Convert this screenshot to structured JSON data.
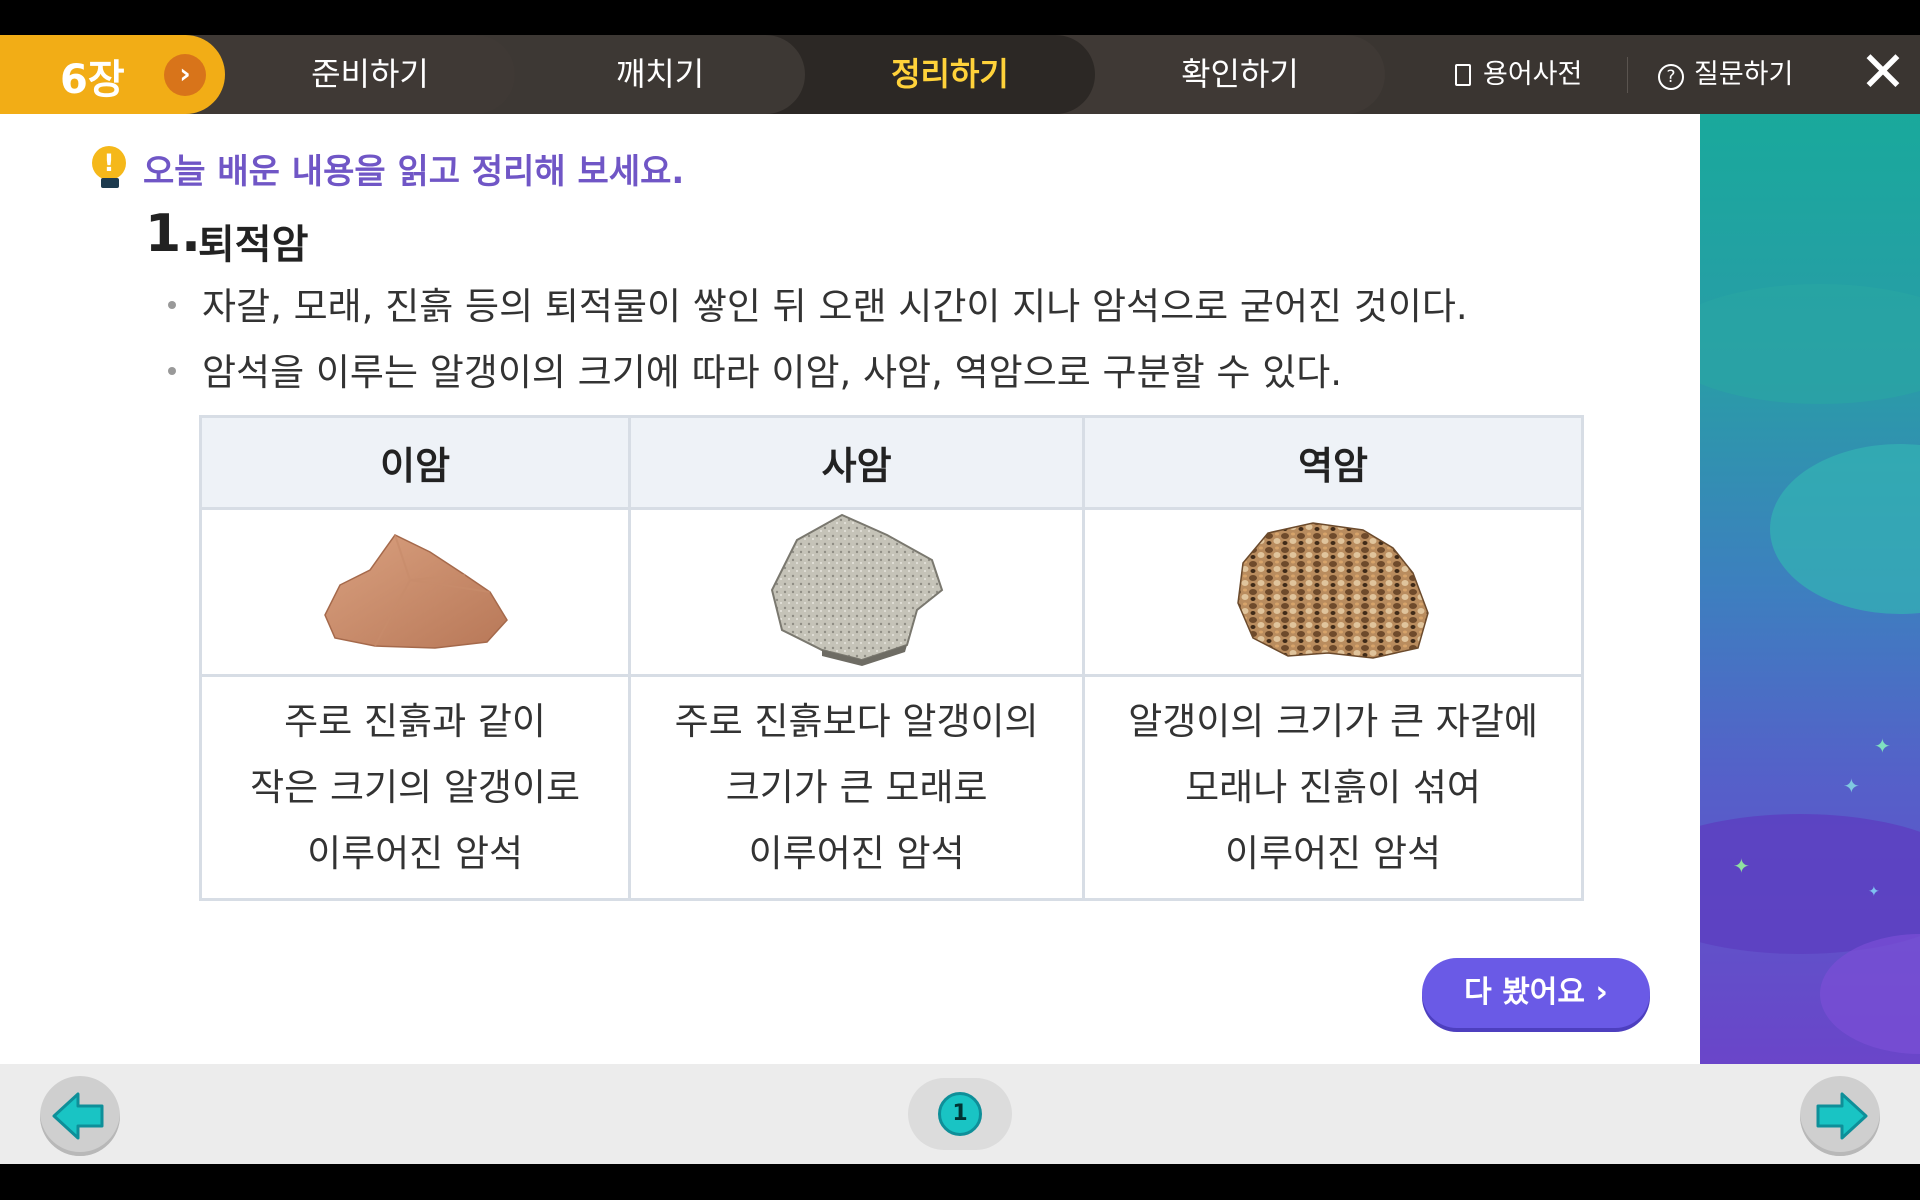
{
  "nav": {
    "chapter": "6장",
    "tabs": [
      {
        "label": "준비하기"
      },
      {
        "label": "깨치기"
      },
      {
        "label": "정리하기"
      },
      {
        "label": "확인하기"
      }
    ],
    "dictionary_label": "용어사전",
    "question_label": "질문하기",
    "active_tab": "정리하기"
  },
  "content": {
    "instruction": "오늘 배운 내용을 읽고 정리해 보세요.",
    "section_number": "1.",
    "section_title": "퇴적암",
    "bullets": [
      "자갈, 모래, 진흙 등의 퇴적물이 쌓인 뒤 오랜 시간이 지나 암석으로 굳어진 것이다.",
      "암석을 이루는 알갱이의 크기에 따라 이암, 사암, 역암으로 구분할 수 있다."
    ],
    "table": {
      "headers": [
        "이암",
        "사암",
        "역암"
      ],
      "descriptions": [
        [
          "주로 진흙과 같이",
          "작은 크기의 알갱이로",
          "이루어진 암석"
        ],
        [
          "주로 진흙보다 알갱이의",
          "크기가 큰 모래로",
          "이루어진 암석"
        ],
        [
          "알갱이의 크기가 큰 자갈에",
          "모래나 진흙이 섞여",
          "이루어진 암석"
        ]
      ],
      "images": [
        "mudstone-image",
        "sandstone-image",
        "conglomerate-image"
      ]
    },
    "done_button": "다 봤어요"
  },
  "footer": {
    "page_number": "1"
  },
  "colors": {
    "chapter_bg": "#f2ad16",
    "active_tab_text": "#ffd23a",
    "instruction_text": "#7056c6",
    "done_button": "#6a5ae6",
    "nav_arrow": "#19c4c4"
  }
}
